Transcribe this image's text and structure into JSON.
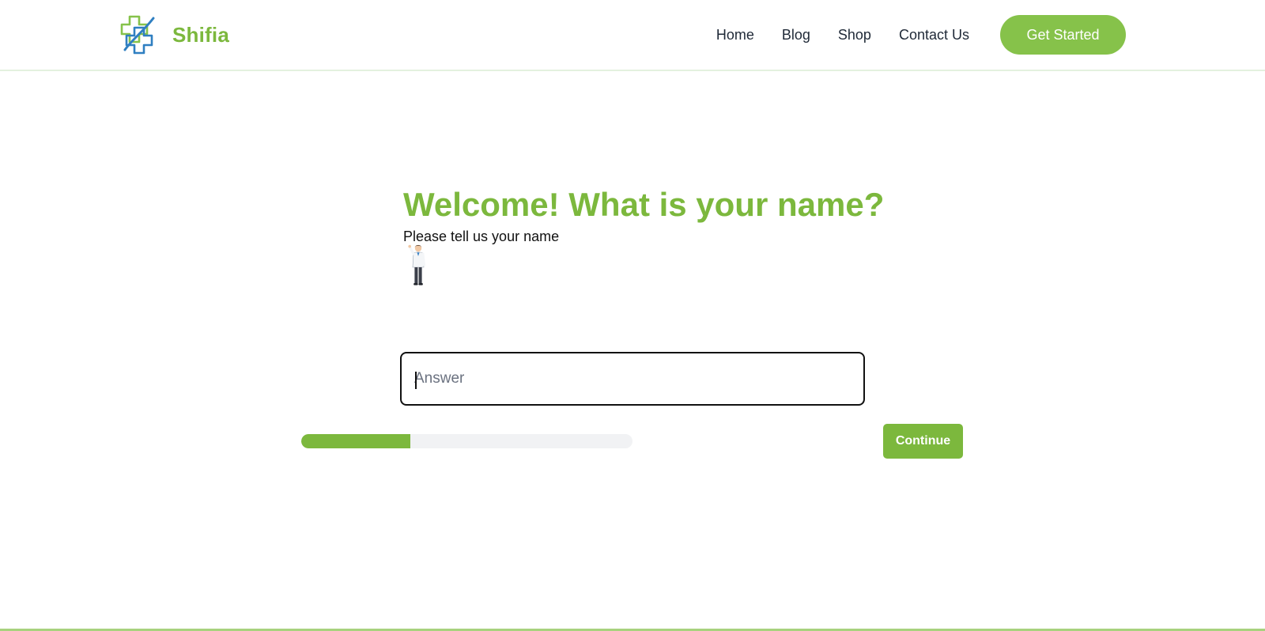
{
  "brand": {
    "name": "Shifia",
    "logo_icon": "medical-cross-logo-icon"
  },
  "nav": {
    "links": [
      "Home",
      "Blog",
      "Shop",
      "Contact Us"
    ],
    "cta_label": "Get Started"
  },
  "question": {
    "title": "Welcome! What is your name?",
    "subtitle": "Please tell us your name",
    "illustration": "doctor-icon"
  },
  "answer": {
    "placeholder": "Answer",
    "value": ""
  },
  "progress": {
    "fraction": 0.33
  },
  "actions": {
    "continue_label": "Continue"
  },
  "colors": {
    "brand_green": "#7cb83d",
    "cta_green": "#86c24a",
    "logo_blue": "#2f7fc1",
    "track_gray": "#f1f2f4"
  }
}
